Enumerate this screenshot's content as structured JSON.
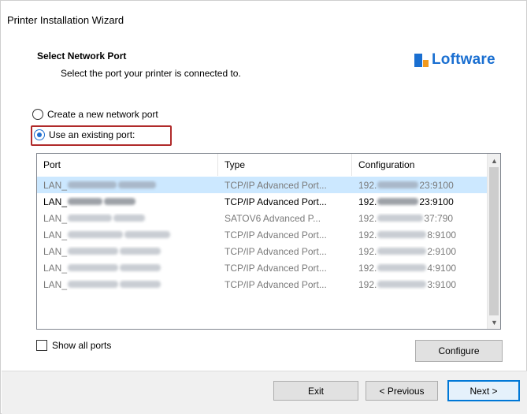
{
  "window": {
    "title": "Printer Installation Wizard"
  },
  "header": {
    "title": "Select Network Port",
    "subtitle": "Select the port your printer is connected to.",
    "logo_text": "Loftware",
    "logo_colors": {
      "primary": "#1a6fd1",
      "accent": "#f29a1e"
    }
  },
  "options": {
    "create_label": "Create a new network port",
    "existing_label": "Use an existing port:",
    "selected": "existing"
  },
  "ports_table": {
    "columns": [
      "Port",
      "Type",
      "Configuration"
    ],
    "rows": [
      {
        "port": "LAN_",
        "type": "TCP/IP Advanced Port...",
        "cfg_prefix": "192.",
        "cfg_suffix": "23:9100",
        "state": "selected"
      },
      {
        "port": "LAN_",
        "type": "TCP/IP Advanced Port...",
        "cfg_prefix": "192.",
        "cfg_suffix": "23:9100",
        "state": "active"
      },
      {
        "port": "LAN_",
        "type": "SATOV6 Advanced P...",
        "cfg_prefix": "192.",
        "cfg_suffix": "37:790",
        "state": "normal"
      },
      {
        "port": "LAN_",
        "type": "TCP/IP Advanced Port...",
        "cfg_prefix": "192.",
        "cfg_suffix": "8:9100",
        "state": "normal"
      },
      {
        "port": "LAN_",
        "type": "TCP/IP Advanced Port...",
        "cfg_prefix": "192.",
        "cfg_suffix": "2:9100",
        "state": "normal"
      },
      {
        "port": "LAN_",
        "type": "TCP/IP Advanced Port...",
        "cfg_prefix": "192.",
        "cfg_suffix": "4:9100",
        "state": "normal"
      },
      {
        "port": "LAN_",
        "type": "TCP/IP Advanced Port...",
        "cfg_prefix": "192.",
        "cfg_suffix": "3:9100",
        "state": "normal"
      }
    ]
  },
  "show_all_ports": {
    "label": "Show all ports",
    "checked": false
  },
  "buttons": {
    "configure": "Configure",
    "exit": "Exit",
    "previous": "< Previous",
    "next": "Next >"
  },
  "icons": {
    "scroll_up": "▲",
    "scroll_down": "▼"
  },
  "colors": {
    "selection": "#cce8ff",
    "highlight_border": "#b02a2a",
    "focus_border": "#0078d7"
  }
}
